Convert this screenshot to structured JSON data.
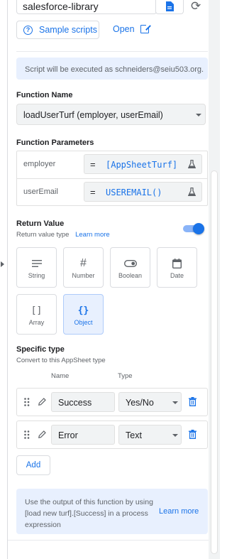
{
  "library": {
    "name": "salesforce-library"
  },
  "actions": {
    "sample_scripts": "Sample scripts",
    "open": "Open"
  },
  "info": {
    "executed_as": "Script will be executed as schneiders@seiu503.org."
  },
  "function_name": {
    "label": "Function Name",
    "value": "loadUserTurf (employer, userEmail)"
  },
  "function_parameters": {
    "label": "Function Parameters",
    "params": [
      {
        "name": "employer",
        "eq": "=",
        "expression": "[AppSheetTurf]"
      },
      {
        "name": "userEmail",
        "eq": "=",
        "expression": "USEREMAIL()"
      }
    ]
  },
  "return_value": {
    "label": "Return Value",
    "type_label": "Return value type",
    "learn_more": "Learn more",
    "enabled": true,
    "types": [
      {
        "name": "String",
        "icon": "lines-icon",
        "selected": false
      },
      {
        "name": "Number",
        "icon": "hash-icon",
        "selected": false
      },
      {
        "name": "Boolean",
        "icon": "toggle-icon",
        "selected": false
      },
      {
        "name": "Date",
        "icon": "calendar-icon",
        "selected": false
      },
      {
        "name": "Array",
        "icon": "brackets-icon",
        "selected": false
      },
      {
        "name": "Object",
        "icon": "braces-icon",
        "selected": true
      }
    ]
  },
  "specific_type": {
    "label": "Specific type",
    "sublabel": "Convert to this AppSheet type",
    "col_name": "Name",
    "col_type": "Type",
    "fields": [
      {
        "name": "Success",
        "type": "Yes/No"
      },
      {
        "name": "Error",
        "type": "Text"
      }
    ],
    "add_label": "Add"
  },
  "footer": {
    "text": "Use the output of this function by using [load new turf].[Success] in a process expression",
    "learn_more": "Learn more"
  },
  "colors": {
    "accent": "#1a73e8",
    "info_bg": "#e8f0fe",
    "field_bg": "#f1f3f4"
  }
}
